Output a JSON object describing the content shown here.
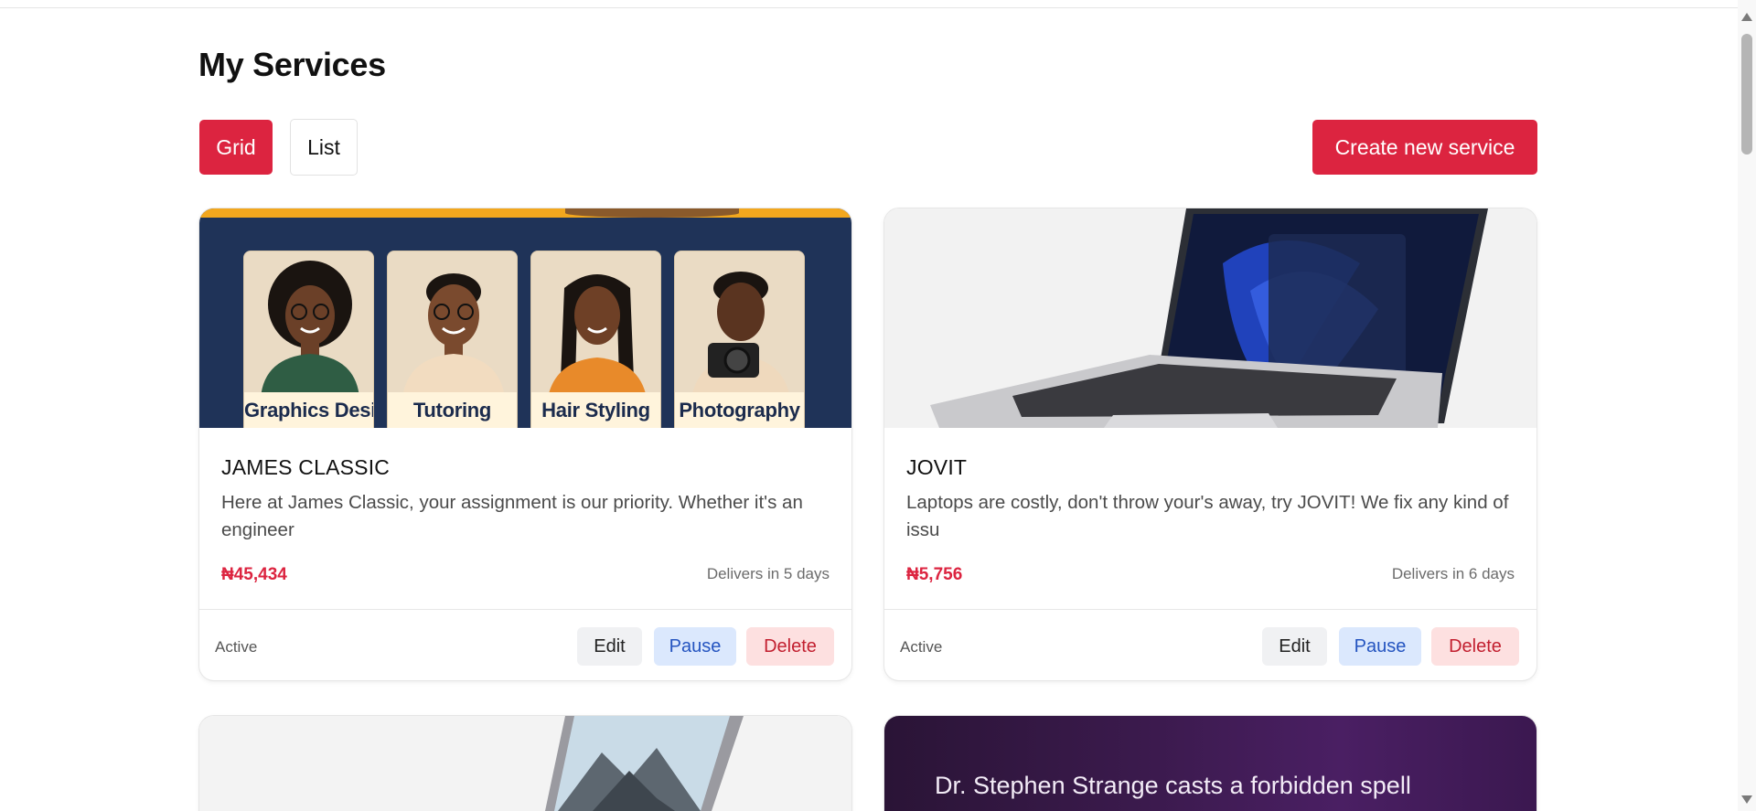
{
  "page": {
    "title": "My Services"
  },
  "toolbar": {
    "grid_label": "Grid",
    "list_label": "List",
    "create_label": "Create new service",
    "active_view": "Grid"
  },
  "colors": {
    "accent": "#dc2440",
    "pause_bg": "#dbe8fd",
    "delete_bg": "#fde0e0"
  },
  "cards": [
    {
      "name": "JAMES CLASSIC",
      "description": "Here at James Classic, your assignment is our priority. Whether it's an engineer",
      "price": "₦45,434",
      "delivery": "Delivers in 5 days",
      "status": "Active",
      "actions": {
        "edit": "Edit",
        "pause": "Pause",
        "delete": "Delete"
      },
      "image": {
        "kind": "service-poster",
        "labels": [
          "Graphics Design",
          "Tutoring",
          "Hair Styling",
          "Photography"
        ]
      }
    },
    {
      "name": "JOVIT",
      "description": "Laptops are costly, don't throw your's away, try JOVIT! We fix any kind of issu",
      "price": "₦5,756",
      "delivery": "Delivers in 6 days",
      "status": "Active",
      "actions": {
        "edit": "Edit",
        "pause": "Pause",
        "delete": "Delete"
      },
      "image": {
        "kind": "laptop-photo"
      }
    },
    {
      "image": {
        "kind": "device-photo"
      }
    },
    {
      "image": {
        "kind": "movie-poster",
        "text": "Dr. Stephen Strange casts a forbidden spell"
      }
    }
  ]
}
